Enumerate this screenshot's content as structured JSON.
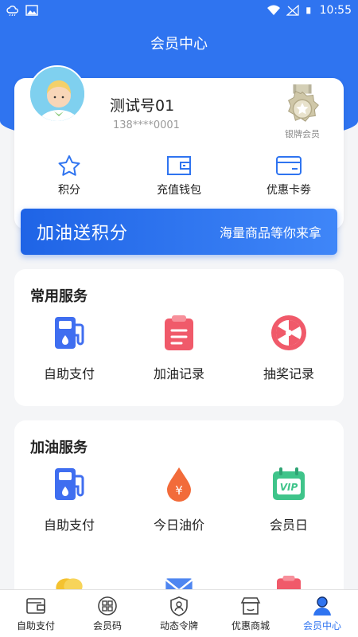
{
  "status": {
    "time": "10:55",
    "icons": [
      "cloud-icon",
      "image-icon",
      "wifi-icon",
      "signal-icon",
      "battery-icon"
    ]
  },
  "header": {
    "title": "会员中心"
  },
  "profile": {
    "name": "测试号01",
    "phone": "138****0001",
    "badge_label": "银牌会员",
    "quick": [
      {
        "label": "积分",
        "icon": "star-icon"
      },
      {
        "label": "充值钱包",
        "icon": "wallet-icon"
      },
      {
        "label": "优惠卡劵",
        "icon": "card-icon"
      }
    ]
  },
  "banner": {
    "big": "加油送积分",
    "small": "海量商品等你来拿"
  },
  "common_services": {
    "title": "常用服务",
    "items": [
      {
        "label": "自助支付",
        "icon": "fuel-pump-icon"
      },
      {
        "label": "加油记录",
        "icon": "clipboard-icon"
      },
      {
        "label": "抽奖记录",
        "icon": "lottery-wheel-icon"
      }
    ]
  },
  "fuel_services": {
    "title": "加油服务",
    "items": [
      {
        "label": "自助支付",
        "icon": "fuel-pump-icon"
      },
      {
        "label": "今日油价",
        "icon": "oil-drop-icon"
      },
      {
        "label": "会员日",
        "icon": "vip-calendar-icon"
      }
    ]
  },
  "nav": [
    {
      "label": "自助支付",
      "icon": "wallet-icon",
      "active": false
    },
    {
      "label": "会员码",
      "icon": "qr-code-icon",
      "active": false
    },
    {
      "label": "动态令牌",
      "icon": "shield-icon",
      "active": false
    },
    {
      "label": "优惠商城",
      "icon": "shop-icon",
      "active": false
    },
    {
      "label": "会员中心",
      "icon": "person-icon",
      "active": true
    }
  ],
  "colors": {
    "brand": "#2f74f0",
    "card": "#ffffff",
    "background": "#f4f5f7"
  }
}
